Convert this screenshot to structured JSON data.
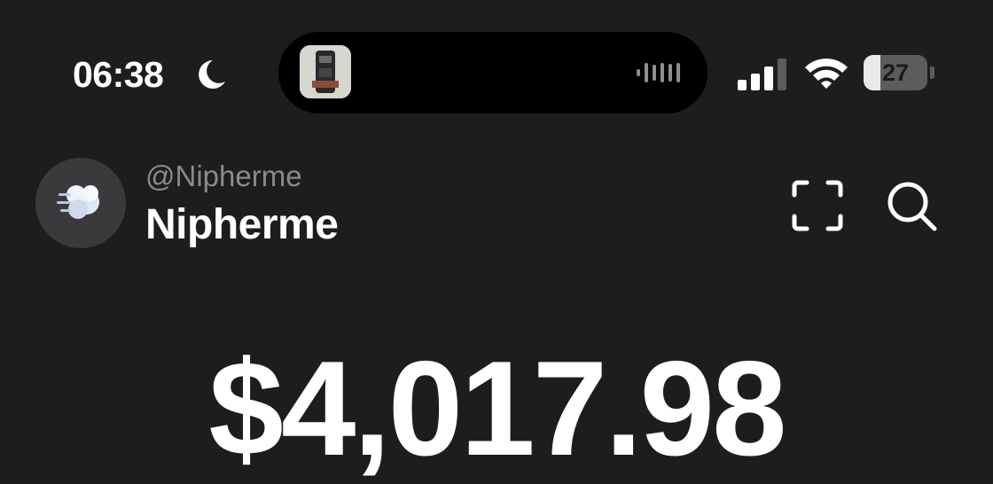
{
  "status_bar": {
    "time": "06:38",
    "focus_icon": "moon-icon",
    "live_activity_icon": "waveform-icon",
    "cellular_icon": "cellular-signal-icon",
    "wifi_icon": "wifi-icon",
    "battery_level": "27"
  },
  "profile": {
    "handle": "@Nipherme",
    "name": "Nipherme",
    "avatar_icon": "dashing-cloud-emoji"
  },
  "actions": {
    "scan_icon": "qr-scan-icon",
    "search_icon": "search-icon"
  },
  "balance": {
    "amount": "$4,017.98"
  },
  "colors": {
    "background": "#1d1d1e",
    "text_primary": "#ffffff",
    "text_secondary": "#8a8a8e"
  }
}
